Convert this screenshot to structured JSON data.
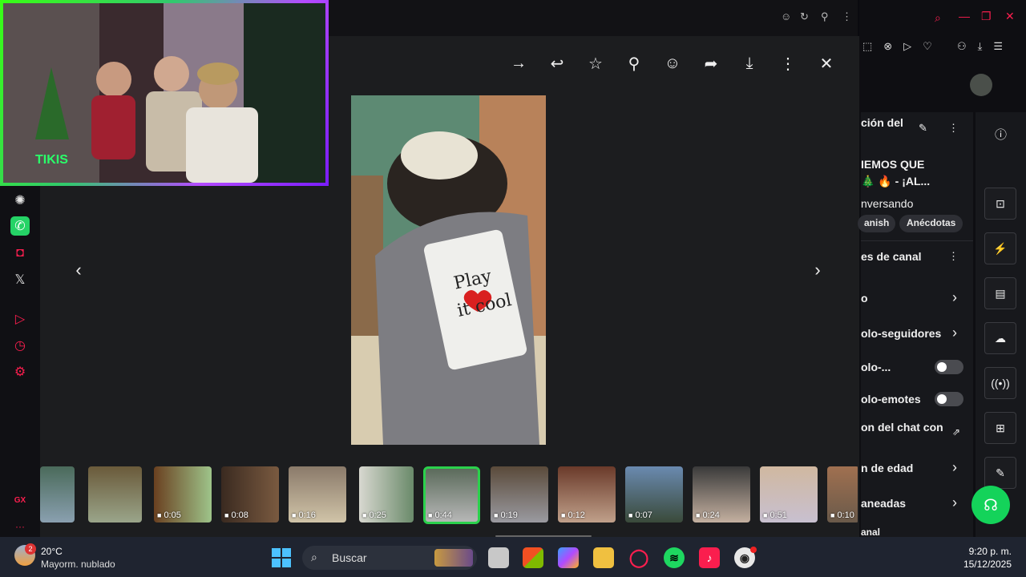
{
  "window_controls": {
    "minimize": "—",
    "maximize": "❐",
    "close": "✕"
  },
  "viewer": {
    "tools": [
      "forward",
      "reply",
      "star",
      "pin",
      "react",
      "share",
      "download",
      "more",
      "close"
    ],
    "shirt_text_line1": "Play",
    "shirt_text_line2": "it cool"
  },
  "thumbnails": [
    {
      "duration": ""
    },
    {
      "duration": ""
    },
    {
      "duration": "0:05"
    },
    {
      "duration": "0:08"
    },
    {
      "duration": "0:16"
    },
    {
      "duration": "0:25"
    },
    {
      "duration": "0:44"
    },
    {
      "duration": "0:19"
    },
    {
      "duration": "0:12"
    },
    {
      "duration": "0:07"
    },
    {
      "duration": "0:24"
    },
    {
      "duration": "0:51"
    },
    {
      "duration": "0:10"
    }
  ],
  "right_panel": {
    "title": "ción del",
    "stream_title_line1": "IEMOS QUE",
    "stream_title_line2": "🎄 🔥 - ¡AL...",
    "category": "nversando",
    "tags": [
      "anish",
      "Anécdotas"
    ],
    "section_title": "es de canal",
    "rows": [
      "o",
      "olo-seguidores",
      "olo-...",
      "olo-emotes",
      "on del chat con",
      "n de edad",
      "aneadas",
      "anal"
    ]
  },
  "sidebar": {
    "gx_label": "GX",
    "more": "···"
  },
  "taskbar": {
    "weather_temp": "20°C",
    "weather_desc": "Mayorm. nublado",
    "weather_badge": "2",
    "search_placeholder": "Buscar",
    "time": "9:20 p. m.",
    "date": "15/12/2025"
  }
}
